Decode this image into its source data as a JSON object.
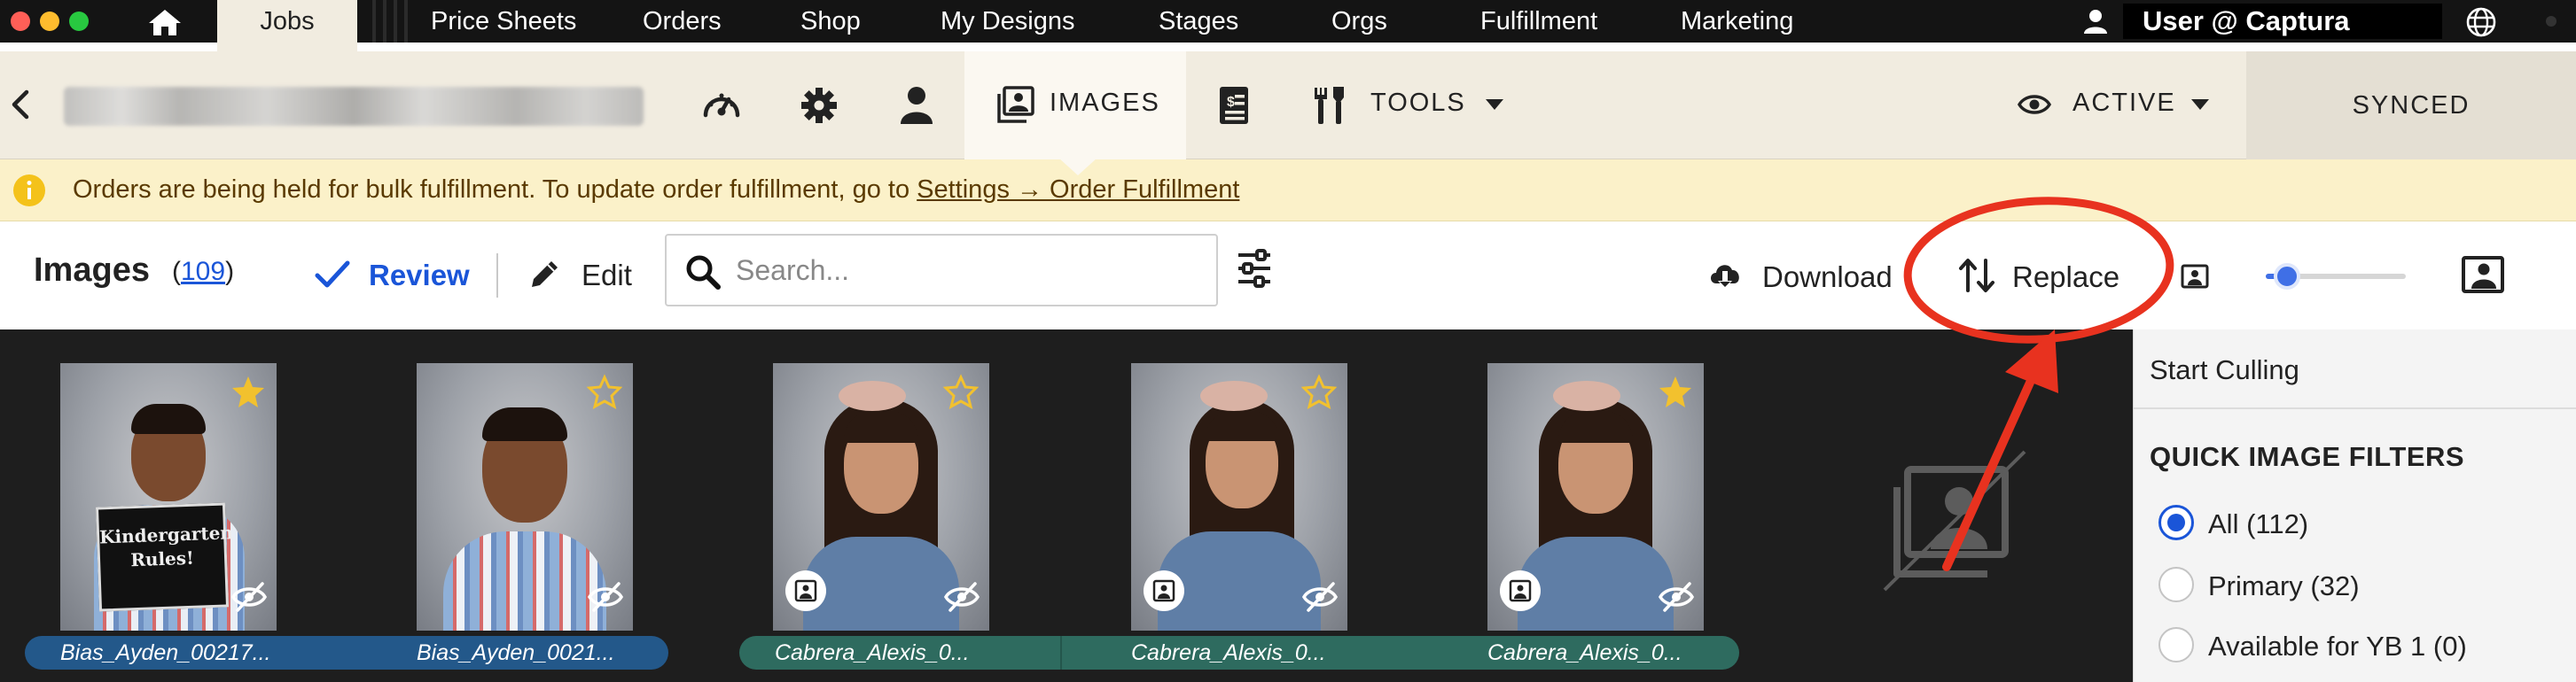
{
  "nav": {
    "items": [
      "Jobs",
      "Price Sheets",
      "Orders",
      "Shop",
      "My Designs",
      "Stages",
      "Orgs",
      "Fulfillment",
      "Marketing"
    ],
    "user": "User @ Captura"
  },
  "job_header": {
    "title_redacted": "",
    "images_tab": "IMAGES",
    "tools_label": "TOOLS",
    "status_filter": "ACTIVE",
    "sync_status": "SYNCED"
  },
  "notice": {
    "message": "Orders are being held for bulk fulfillment. To update order fulfillment, go to ",
    "link": "Settings → Order Fulfillment"
  },
  "toolbar": {
    "title": "Images",
    "count": "109",
    "review_label": "Review",
    "edit_label": "Edit",
    "search_placeholder": "Search...",
    "download_label": "Download",
    "replace_label": "Replace",
    "thumbnail_size_fraction": 0.15
  },
  "gallery": {
    "images": [
      {
        "filename": "Bias_Ayden_00217...",
        "starred": true,
        "hidden": true,
        "primary": false,
        "group": "blue",
        "sign_text": "Kindergarten Rules!"
      },
      {
        "filename": "Bias_Ayden_0021...",
        "starred": false,
        "hidden": true,
        "primary": false,
        "group": "blue",
        "sign_text": ""
      },
      {
        "filename": "Cabrera_Alexis_0...",
        "starred": false,
        "hidden": true,
        "primary": true,
        "group": "teal",
        "sign_text": ""
      },
      {
        "filename": "Cabrera_Alexis_0...",
        "starred": false,
        "hidden": true,
        "primary": true,
        "group": "teal",
        "sign_text": ""
      },
      {
        "filename": "Cabrera_Alexis_0...",
        "starred": true,
        "hidden": true,
        "primary": true,
        "group": "teal",
        "sign_text": ""
      }
    ]
  },
  "side_panel": {
    "start_culling": "Start Culling",
    "filters_title": "QUICK IMAGE FILTERS",
    "filters": [
      {
        "label": "All (112)",
        "selected": true
      },
      {
        "label": "Primary (32)",
        "selected": false
      },
      {
        "label": "Available for YB 1 (0)",
        "selected": false
      }
    ]
  },
  "colors": {
    "topbar": "#141414",
    "header_bg": "#f1ece0",
    "notice_bg": "#fbf1c9",
    "accent_blue": "#1a55d8",
    "gallery_bg": "#1e1e1e",
    "star": "#f2c12e",
    "annotation_red": "#e8321f"
  }
}
